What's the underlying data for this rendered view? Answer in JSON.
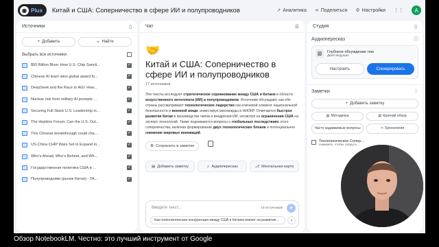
{
  "app": {
    "logo_badge": "Plus",
    "notebook_title": "Китай и США: Соперничество в сфере ИИ и полупроводников"
  },
  "topbar": {
    "analytics": "Аналитика",
    "share": "Поделиться",
    "settings": "Настройки",
    "avatar_letter": "A"
  },
  "sources": {
    "header": "Источники",
    "add_label": "Добавить",
    "find_label": "Найти",
    "select_all": "Выбрать все источники",
    "items": [
      {
        "label": "$55 Billion Blow: How U.S. Chip Sancti..."
      },
      {
        "label": "Chinese AI team wins global award fo..."
      },
      {
        "label": "DeepSeek and the Race to AGI: How..."
      },
      {
        "label": "Nuclear risk from military AI prompts ..."
      },
      {
        "label": "Securing Full Stack U.S. Leadership in..."
      },
      {
        "label": "The Hopkins Forum: Can the U.S. Out..."
      },
      {
        "label": "This Chinese breakthrough could cha..."
      },
      {
        "label": "US-China CHIP Wars Set to Expand in..."
      },
      {
        "label": "Who's Ahead, Who's Behind, and Wh..."
      },
      {
        "label": "Государственная политика США в ..."
      },
      {
        "label": "Полупроводники (рынок Китая) - TA..."
      }
    ]
  },
  "chat": {
    "header": "Чат",
    "emoji": "🤝",
    "title": "Китай и США: Соперничество в сфере ИИ и полупроводников",
    "source_count": "17 источников",
    "summary": {
      "s1": "Эти тексты исследуют ",
      "b1": "стратегическое соревнование между США и Китаем",
      "s2": " в области ",
      "b2": "искусственного интеллекта (ИИ) и полупроводников",
      "s3": ". Источники обсуждают, как обе страны рассматривают ",
      "b3": "технологическое лидерство",
      "s4": " как ключевой элемент национальной безопасности и ",
      "b4": "военной мощи",
      "s5": ", инвестируя миллиарды в НИОКР. Отмечается ",
      "b5": "быстрое развитие Китая",
      "s6": " в производстве чипов и внедрении ИИ, несмотря на ",
      "b6": "ограничения США",
      "s7": " на экспорт технологий. Также поднимаются вопросы о ",
      "b7": "глобальных последствиях",
      "s8": " этого соперничества, включая формирование ",
      "b8": "двух технологических блоков",
      "s9": " и потенциальное ",
      "b9": "снижение мировых инноваций",
      "s10": "."
    },
    "save_note": "Сохранить в заметке",
    "suggestions": [
      "Добавить заметку",
      "Аудиопересказ",
      "Ментальная карта"
    ],
    "input_placeholder": "Введите текст...",
    "input_source_count": "19 источников",
    "suggested_question": "Как геополитическая конкуренция между США и Китаем влияет на развитие..."
  },
  "studio": {
    "header": "Студия",
    "audio_section": "Аудиопересказ",
    "audio_title": "Глубокое обсуждение тем",
    "audio_sub": "Двое ведущих",
    "customize": "Настроить",
    "generate": "Сгенерировать",
    "notes_section": "Заметки",
    "add_note": "Добавить заметку",
    "note_buttons": [
      "Методичка",
      "Краткий обзор",
      "Часто задаваемые вопросы",
      "Хронология"
    ],
    "note_title": "Технологическое Сопер...",
    "note_sub": "Нажмите, чтобы открыть..."
  },
  "video": {
    "caption": "Обзор NotebookLM. Честно: это лучший инструмент от Google"
  }
}
